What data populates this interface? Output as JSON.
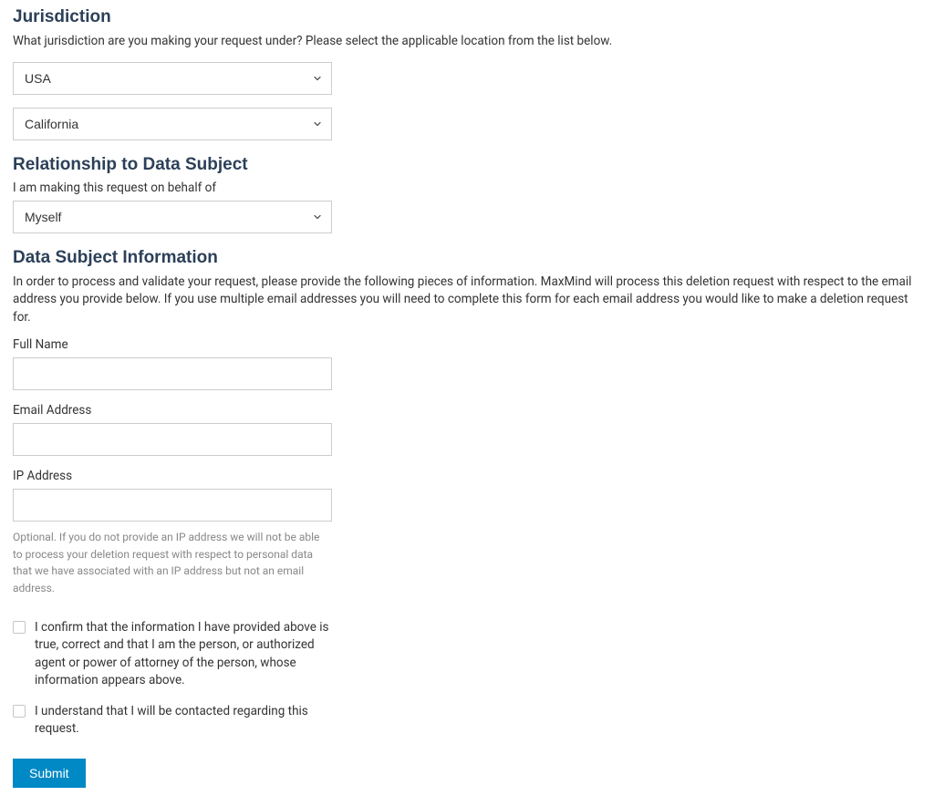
{
  "jurisdiction": {
    "heading": "Jurisdiction",
    "desc": "What jurisdiction are you making your request under? Please select the applicable location from the list below.",
    "country_value": "USA",
    "region_value": "California"
  },
  "relationship": {
    "heading": "Relationship to Data Subject",
    "label": "I am making this request on behalf of",
    "value": "Myself"
  },
  "subject_info": {
    "heading": "Data Subject Information",
    "desc": "In order to process and validate your request, please provide the following pieces of information. MaxMind will process this deletion request with respect to the email address you provide below. If you use multiple email addresses you will need to complete this form for each email address you would like to make a deletion request for.",
    "full_name_label": "Full Name",
    "full_name_value": "",
    "email_label": "Email Address",
    "email_value": "",
    "ip_label": "IP Address",
    "ip_value": "",
    "ip_help": "Optional. If you do not provide an IP address we will not be able to process your deletion request with respect to personal data that we have associated with an IP address but not an email address."
  },
  "checkboxes": {
    "confirm_label": "I confirm that the information I have provided above is true, correct and that I am the person, or authorized agent or power of attorney of the person, whose information appears above.",
    "contact_label": "I understand that I will be contacted regarding this request."
  },
  "submit_label": "Submit"
}
